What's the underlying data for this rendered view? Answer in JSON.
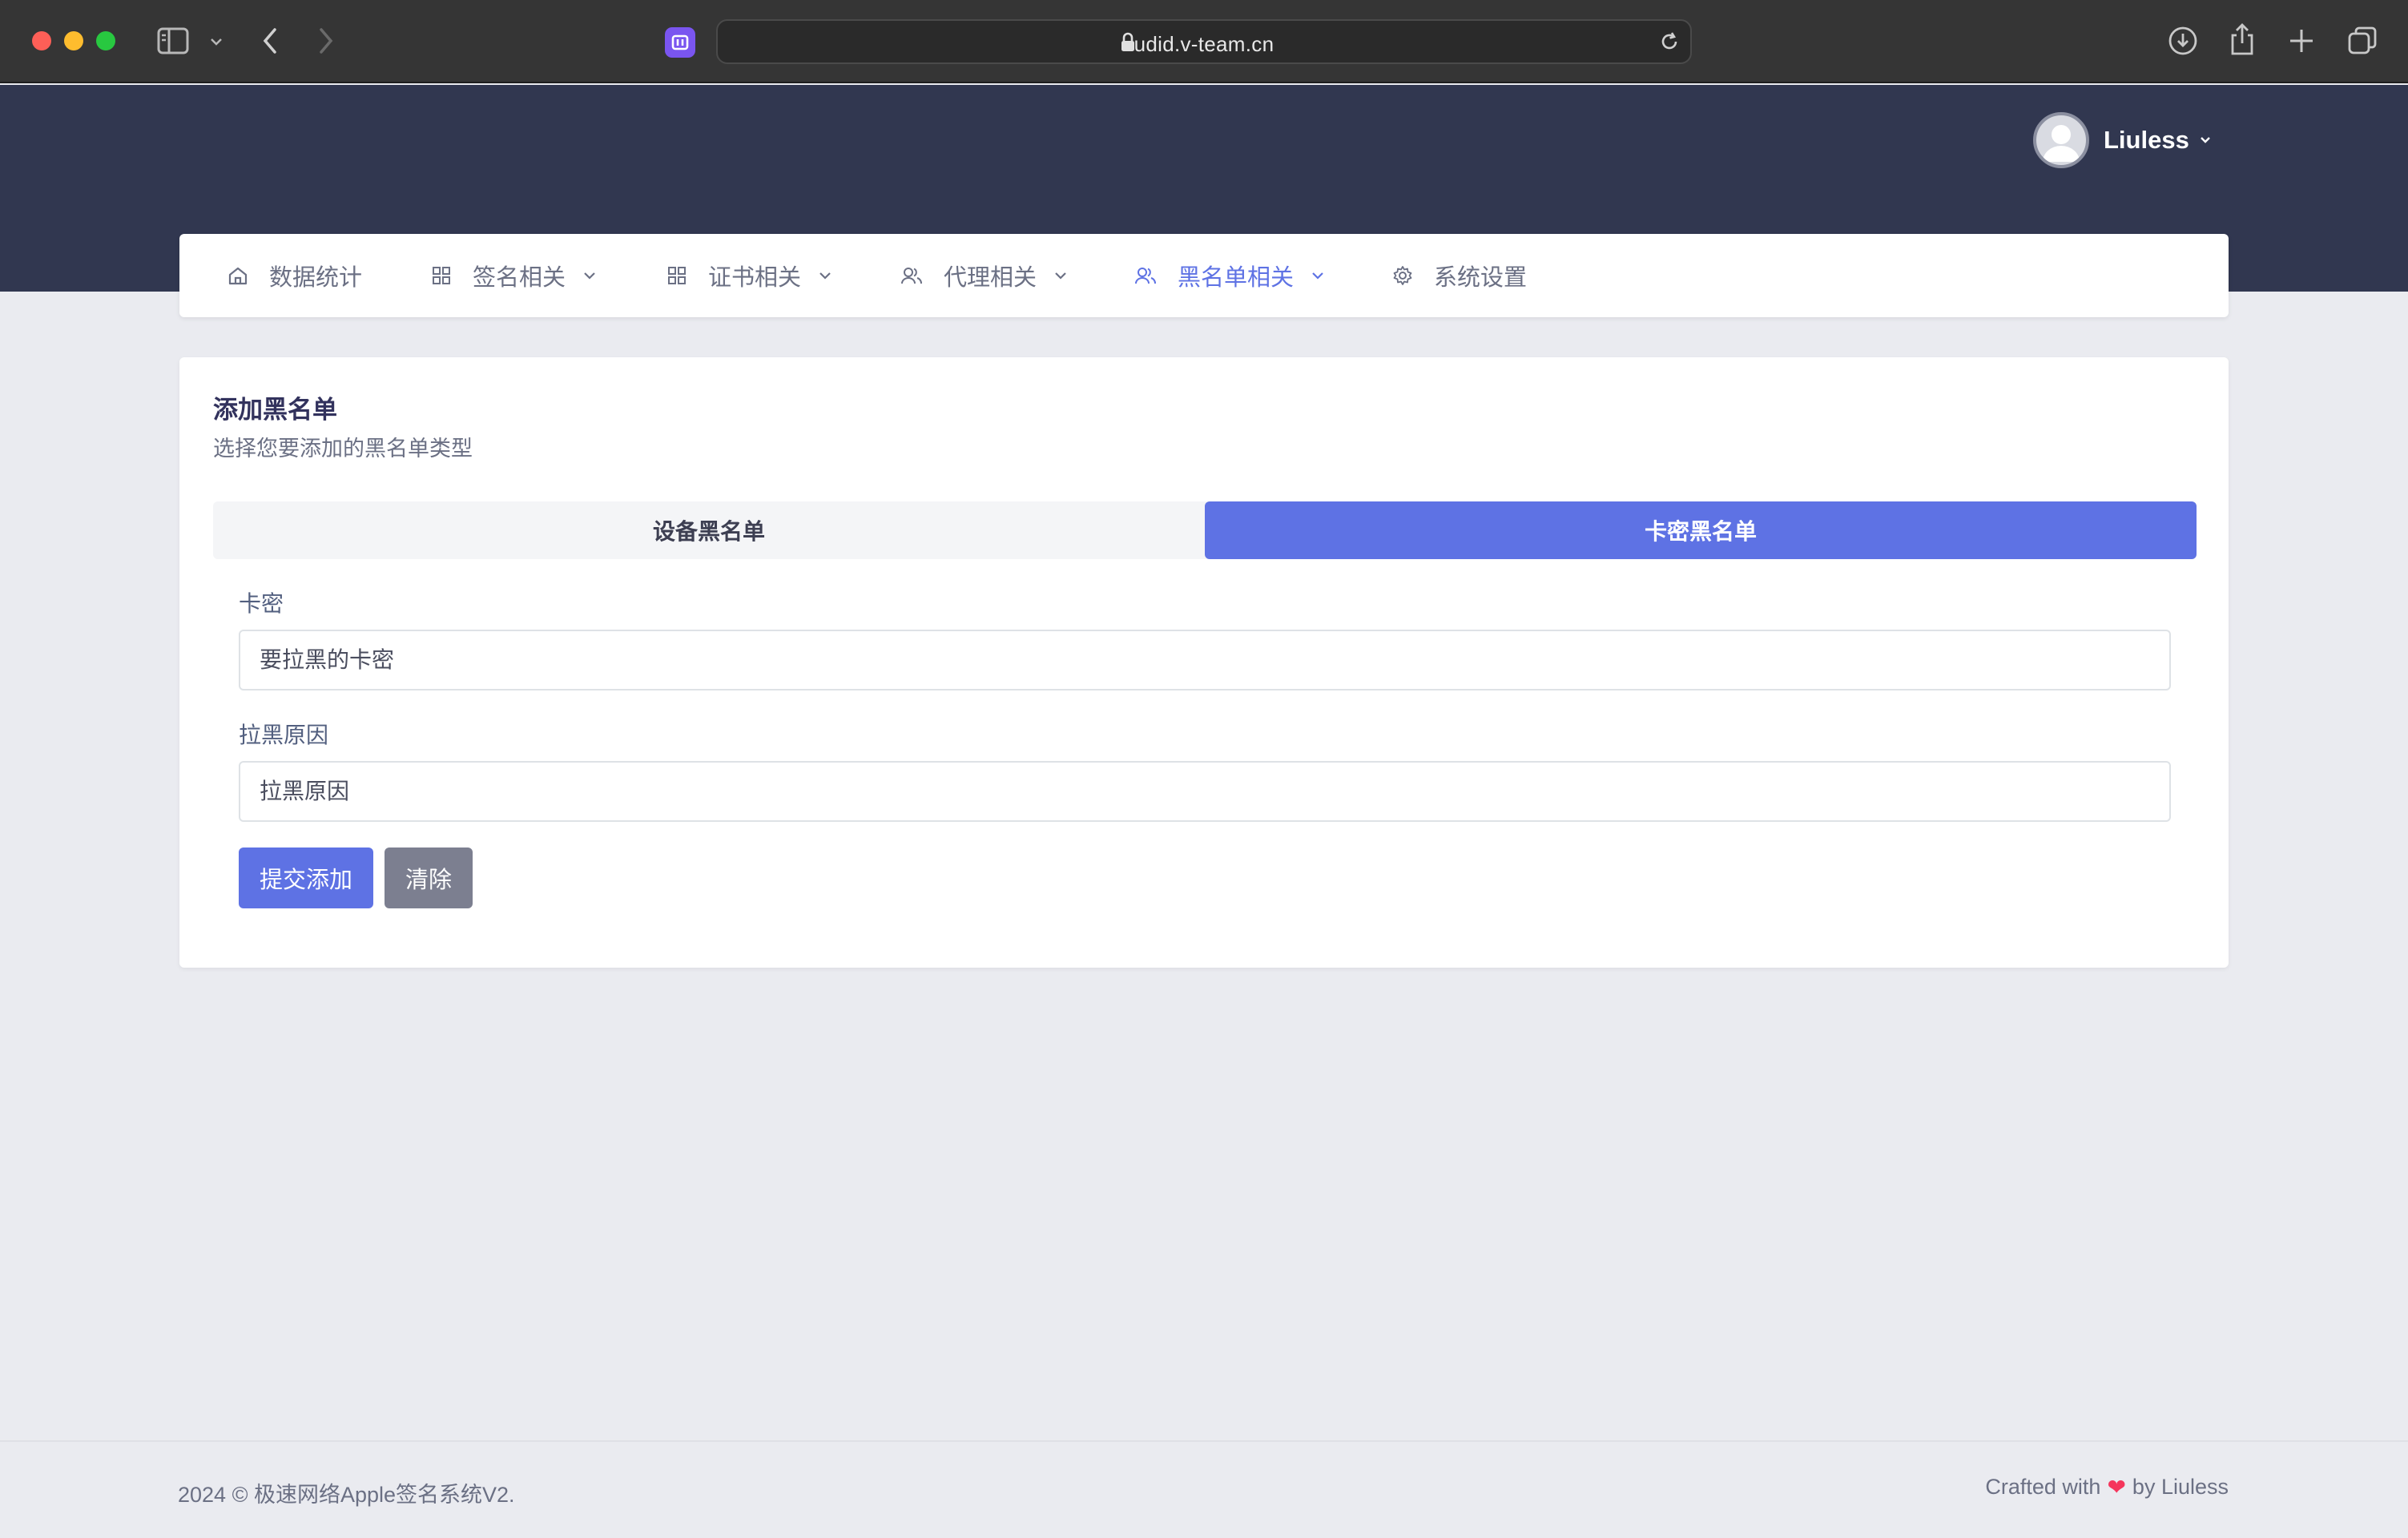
{
  "browser": {
    "url": "udid.v-team.cn",
    "icons": [
      "sidebar-icon",
      "chevron-down-icon",
      "back-icon",
      "forward-icon",
      "lock-icon",
      "reload-icon",
      "download-icon",
      "share-icon",
      "new-tab-icon",
      "tab-overview-icon"
    ]
  },
  "header": {
    "user_name": "Liuless"
  },
  "nav": {
    "items": [
      {
        "label": "数据统计",
        "icon": "home-icon",
        "dropdown": false,
        "active": false
      },
      {
        "label": "签名相关",
        "icon": "grid-icon",
        "dropdown": true,
        "active": false
      },
      {
        "label": "证书相关",
        "icon": "grid-icon",
        "dropdown": true,
        "active": false
      },
      {
        "label": "代理相关",
        "icon": "users-icon",
        "dropdown": true,
        "active": false
      },
      {
        "label": "黑名单相关",
        "icon": "users-icon",
        "dropdown": true,
        "active": true
      },
      {
        "label": "系统设置",
        "icon": "gear-icon",
        "dropdown": false,
        "active": false
      }
    ]
  },
  "card": {
    "title": "添加黑名单",
    "subtitle": "选择您要添加的黑名单类型",
    "tabs": [
      {
        "label": "设备黑名单",
        "selected": false
      },
      {
        "label": "卡密黑名单",
        "selected": true
      }
    ],
    "fields": [
      {
        "label": "卡密",
        "value": "",
        "placeholder": "要拉黑的卡密"
      },
      {
        "label": "拉黑原因",
        "value": "",
        "placeholder": "拉黑原因"
      }
    ],
    "submit_label": "提交添加",
    "clear_label": "清除"
  },
  "footer": {
    "copyright": "2024 © 极速网络Apple签名系统V2.",
    "crafted_prefix": "Crafted with",
    "crafted_heart": "❤",
    "crafted_suffix": "by Liuless"
  },
  "colors": {
    "header_bg": "#313750",
    "accent": "#5e72e4",
    "secondary_button": "#7c7f90",
    "page_bg": "#eaebf0"
  }
}
